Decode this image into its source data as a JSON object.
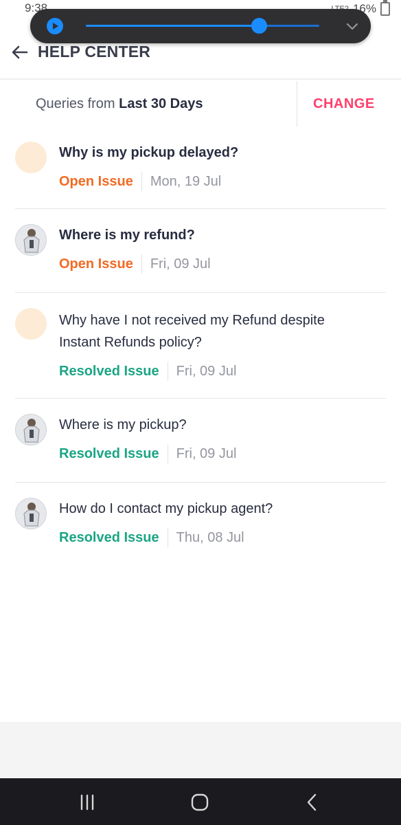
{
  "status_bar": {
    "time": "9:38",
    "network": "LTE2",
    "battery": "16%"
  },
  "media_overlay": {
    "progress": 0.74,
    "play_icon": "play-icon",
    "collapse_icon": "chevron-down-icon"
  },
  "header": {
    "title": "HELP CENTER",
    "back_icon": "arrow-left-icon"
  },
  "filter": {
    "prefix": "Queries from ",
    "range": "Last 30 Days",
    "change_label": "CHANGE"
  },
  "queries": [
    {
      "title": "Why is my pickup delayed?",
      "status": "Open Issue",
      "date": "Mon, 19 Jul"
    },
    {
      "title": "Where is my refund?",
      "status": "Open Issue",
      "date": "Fri, 09 Jul"
    },
    {
      "title": "Why have I not received my Refund despite Instant Refunds policy?",
      "status": "Resolved Issue",
      "date": "Fri, 09 Jul"
    },
    {
      "title": "Where is my pickup?",
      "status": "Resolved Issue",
      "date": "Fri, 09 Jul"
    },
    {
      "title": "How do I contact my pickup agent?",
      "status": "Resolved Issue",
      "date": "Thu, 08 Jul"
    }
  ],
  "colors": {
    "accent": "#ff3f6c",
    "open": "#f26a24",
    "resolved": "#1aa584",
    "media_blue": "#1a8cff"
  },
  "nav": {
    "recents_icon": "recents-icon",
    "home_icon": "home-icon",
    "back_icon": "back-chevron-icon"
  }
}
